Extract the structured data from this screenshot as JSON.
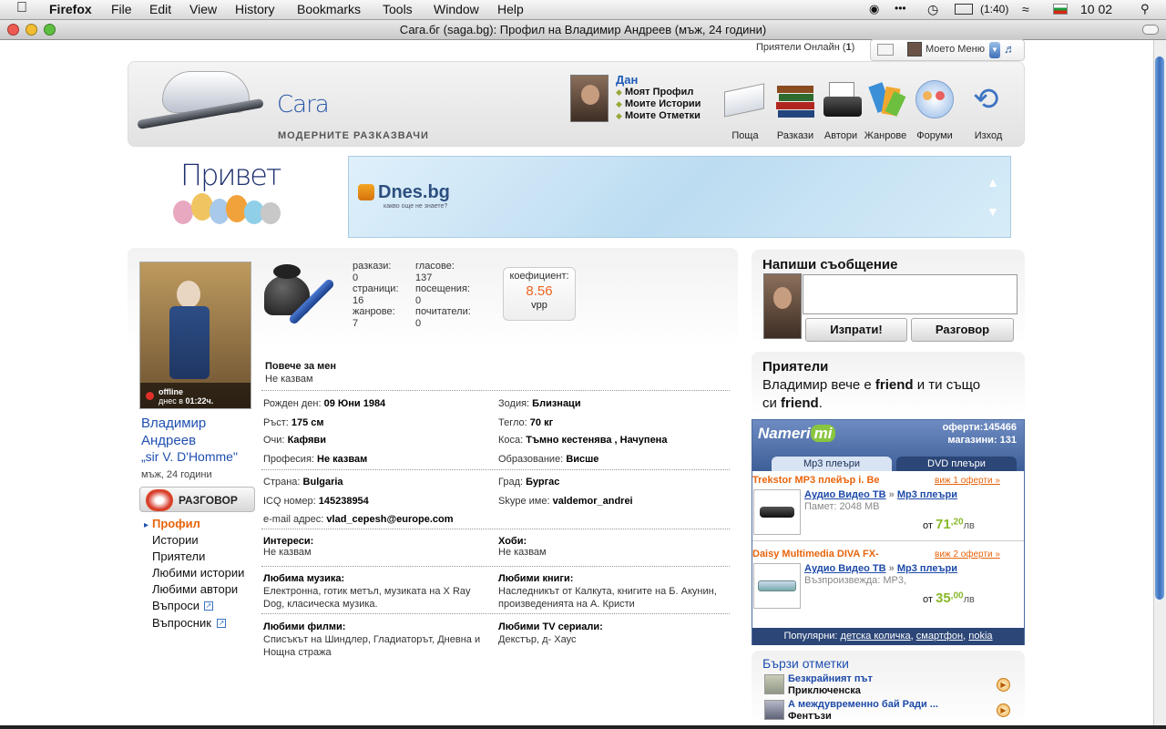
{
  "mac_menu": {
    "app": "Firefox",
    "items": [
      "File",
      "Edit",
      "View",
      "History",
      "Bookmarks",
      "Tools",
      "Window",
      "Help"
    ],
    "battery": "(1:40)",
    "clock": "10 02"
  },
  "window": {
    "title": "Сага.бг (saga.bg): Профил на Владимир Андреев (мъж, 24 години)"
  },
  "topbar": {
    "friends_online_label": "Приятели Онлайн",
    "friends_online_count": "1",
    "my_menu": "Моето Меню"
  },
  "header": {
    "logo_text": "Cara",
    "tagline": "МОДЕРНИТЕ РАЗКАЗВАЧИ",
    "user_name": "Дан",
    "user_links": [
      "Моят Профил",
      "Моите Истории",
      "Моите Отметки"
    ],
    "nav": [
      {
        "label": "Поща",
        "icon": "mail-icon"
      },
      {
        "label": "Разкази",
        "icon": "books-icon"
      },
      {
        "label": "Автори",
        "icon": "typewriter-icon"
      },
      {
        "label": "Жанрове",
        "icon": "genres-icon"
      },
      {
        "label": "Форуми",
        "icon": "forums-icon"
      },
      {
        "label": "Изход",
        "icon": "logout-arrow-icon"
      }
    ]
  },
  "banner": {
    "greeting": "Привет",
    "ad_brand": "Dnes.bg",
    "ad_tagline": "какво още не знаете?"
  },
  "profile": {
    "status": "offline",
    "last_seen_prefix": "днес в",
    "last_seen_time": "01:22ч.",
    "first_name": "Владимир",
    "last_name": "Андреев",
    "nickname": "„sir V. D'Homme\"",
    "meta": "мъж, 24 години",
    "chat_button": "РАЗГОВОР",
    "menu": [
      "Профил",
      "Истории",
      "Приятели",
      "Любими истории",
      "Любими автори",
      "Въпроси",
      "Въпросник"
    ],
    "active_menu": "Профил"
  },
  "stats": {
    "stories_label": "разкази:",
    "stories": "0",
    "votes_label": "гласове:",
    "votes": "137",
    "pages_label": "страници:",
    "pages": "16",
    "visits_label": "посещения:",
    "visits": "0",
    "genres_label": "жанрове:",
    "genres": "7",
    "fans_label": "почитатели:",
    "fans": "0",
    "coef_label": "коефициент:",
    "coef": "8.56",
    "coef_unit": "vpp"
  },
  "about": {
    "title": "Повече за мен",
    "text": "Не казвам"
  },
  "details": {
    "birthday_label": "Рожден ден:",
    "birthday": "09 Юни 1984",
    "zodiac_label": "Зодия:",
    "zodiac": "Близнаци",
    "height_label": "Ръст:",
    "height": "175 см",
    "weight_label": "Тегло:",
    "weight": "70 кг",
    "eyes_label": "Очи:",
    "eyes": "Кафяви",
    "hair_label": "Коса:",
    "hair": "Тъмно кестенява , Начупена",
    "profession_label": "Професия:",
    "profession": "Не казвам",
    "education_label": "Образование:",
    "education": "Висше",
    "country_label": "Страна:",
    "country": "Bulgaria",
    "city_label": "Град:",
    "city": "Бургас",
    "icq_label": "ICQ номер:",
    "icq": "145238954",
    "skype_label": "Skype име:",
    "skype": "valdemor_andrei",
    "email_label": "e-mail адрес:",
    "email": "vlad_cepesh@europe.com"
  },
  "interests": {
    "interests_title": "Интереси:",
    "interests": "Не казвам",
    "hobbies_title": "Хоби:",
    "hobbies": "Не казвам",
    "music_title": "Любима музика:",
    "music": "Електронна, готик метъл, музиката на X Ray Dog, класическа музика.",
    "books_title": "Любими книги:",
    "books": "Наследникът от Калкута, книгите на Б. Акунин, произведенията на А. Кристи",
    "films_title": "Любими филми:",
    "films": "Списъкът на Шиндлер, Гладиаторът, Дневна и Нощна стража",
    "tv_title": "Любими TV сериали:",
    "tv": "Декстър, д- Хаус"
  },
  "message": {
    "title": "Напиши съобщение",
    "send": "Изпрати!",
    "chat": "Разговор"
  },
  "friends": {
    "title": "Приятели",
    "text1": "Владимир вече е ",
    "friend": "friend",
    "text2": " и ти също",
    "text3": "си ",
    "text4": "."
  },
  "shop": {
    "logo": "Nameri",
    "logo2": "mi",
    "offers_label": "оферти:",
    "offers": "145466",
    "stores_label": "магазини:",
    "stores": "131",
    "tabs": [
      "Mp3 плеъри",
      "DVD плеъри"
    ],
    "products": [
      {
        "title": "Trekstor MP3 плейър i. Be",
        "offers": "виж 1 оферти »",
        "cat1": "Аудио Видео ТВ",
        "cat2": "Mp3 плеъри",
        "desc": "Памет: 2048 MB",
        "price_prefix": "от",
        "price_main": "71",
        "price_dec": ",20",
        "price_cur": "лв"
      },
      {
        "title": "Daisy Multimedia DIVA FX-",
        "offers": "виж 2 оферти »",
        "cat1": "Аудио Видео ТВ",
        "cat2": "Mp3 плеъри",
        "desc": "Възпроизвежда: MP3,",
        "price_prefix": "от",
        "price_main": "35",
        "price_dec": ",00",
        "price_cur": "лв"
      }
    ],
    "popular_label": "Популярни:",
    "popular": [
      "детска количка",
      "смартфон",
      "nokia"
    ]
  },
  "bookmarks": {
    "title": "Бързи отметки",
    "items": [
      {
        "title": "Безкрайният път",
        "genre": "Приключенска"
      },
      {
        "title": "А междувременно бай Ради ...",
        "genre": "Фентъзи"
      }
    ]
  },
  "colors": {
    "accent_orange": "#e8640c",
    "link_blue": "#1d4aa8",
    "coef_orange": "#f0641e",
    "shop_blue": "#3d5e97"
  }
}
